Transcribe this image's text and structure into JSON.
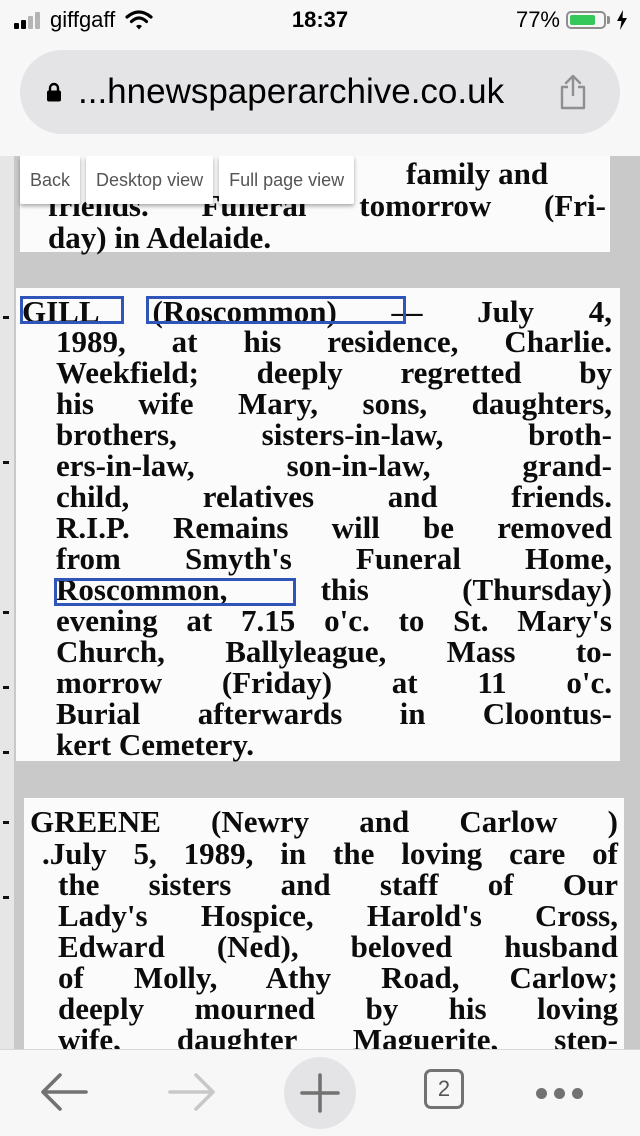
{
  "status_bar": {
    "carrier": "giffgaff",
    "time": "18:37",
    "battery_percent": "77%",
    "battery_level": 0.77,
    "battery_color": "#34c759",
    "signal_bars_active": 2,
    "signal_bars_total": 4,
    "icons": [
      "signal-icon",
      "wifi-icon",
      "battery-icon",
      "charging-icon"
    ]
  },
  "browser": {
    "url_display": "...hnewspaperarchive.co.uk",
    "icons": [
      "lock-icon",
      "share-icon"
    ]
  },
  "archive_toolbar": {
    "back_label": "Back",
    "desktop_view_label": "Desktop view",
    "full_page_view_label": "Full page view"
  },
  "clipping": {
    "top_fragment": [
      "family and",
      "friends. Funeral tomorrow (Fri-",
      "day) in Adelaide."
    ],
    "gill_notice": [
      "GILL (Roscommon) — July 4,",
      "1989, at his residence, Charlie.",
      "Weekfield; deeply regretted by",
      "his wife Mary, sons, daughters,",
      "brothers, sisters-in-law, broth-",
      "ers-in-law, son-in-law, grand-",
      "child, relatives and friends.",
      "R.I.P. Remains will be removed",
      "from Smyth's Funeral Home,",
      "Roscommon, this (Thursday)",
      "evening at 7.15 o'c. to St. Mary's",
      "Church, Ballyleague, Mass to-",
      "morrow (Friday) at 11 o'c.",
      "Burial afterwards in Cloontus-",
      "kert Cemetery."
    ],
    "greene_notice": [
      "GREENE (Newry and Carlow )",
      ".July 5, 1989, in the loving care of",
      "the sisters and staff of Our",
      "Lady's Hospice, Harold's Cross,",
      "Edward (Ned), beloved husband",
      "of Molly, Athy Road, Carlow;",
      "deeply mourned by his loving",
      "wife, daughter Maguerite, step-"
    ],
    "highlight_color": "#2f55b8",
    "highlighted_terms": [
      "GILL",
      "(Roscommon)",
      "Roscommon,"
    ]
  },
  "bottom_toolbar": {
    "tab_count": "2",
    "icons": [
      "back-arrow-icon",
      "forward-arrow-icon",
      "new-tab-plus-icon",
      "tabs-icon",
      "more-icon"
    ]
  }
}
